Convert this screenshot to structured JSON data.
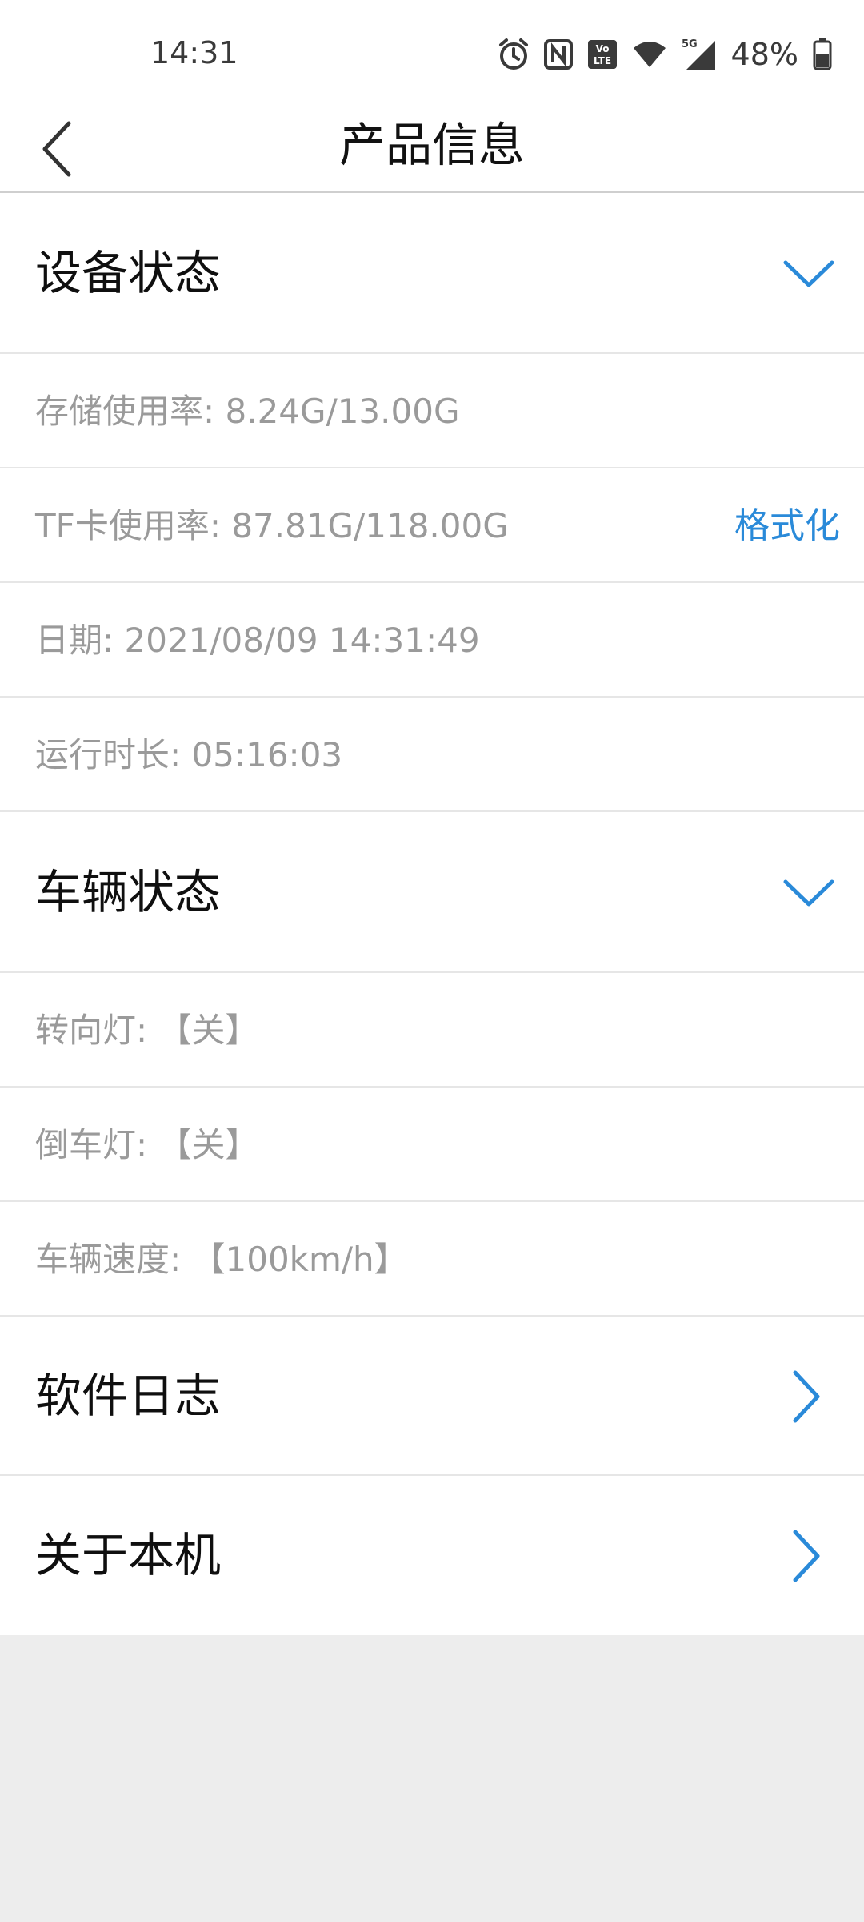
{
  "status_bar": {
    "time": "14:31",
    "battery": "48%",
    "icons": [
      "alarm-icon",
      "nfc-icon",
      "volte-icon",
      "wifi-icon",
      "signal-5g-icon",
      "battery-icon"
    ]
  },
  "app_bar": {
    "title": "产品信息",
    "back_icon": "chevron-left-icon"
  },
  "device_status": {
    "title": "设备状态",
    "toggle_icon": "chevron-down-icon",
    "storage_usage": "存储使用率: 8.24G/13.00G",
    "tf_usage": "TF卡使用率: 87.81G/118.00G",
    "format_label": "格式化",
    "date": "日期: 2021/08/09 14:31:49",
    "uptime": "运行时长: 05:16:03"
  },
  "vehicle_status": {
    "title": "车辆状态",
    "toggle_icon": "chevron-down-icon",
    "turn_signal": "转向灯: 【关】",
    "reverse_light": "倒车灯: 【关】",
    "speed": "车辆速度: 【100km/h】"
  },
  "nav": {
    "software_log": "软件日志",
    "about_device": "关于本机",
    "arrow_icon": "chevron-right-icon"
  },
  "colors": {
    "accent": "#2a8ad9",
    "page_background": "#ededed",
    "secondary_text": "#9a9a9a"
  }
}
